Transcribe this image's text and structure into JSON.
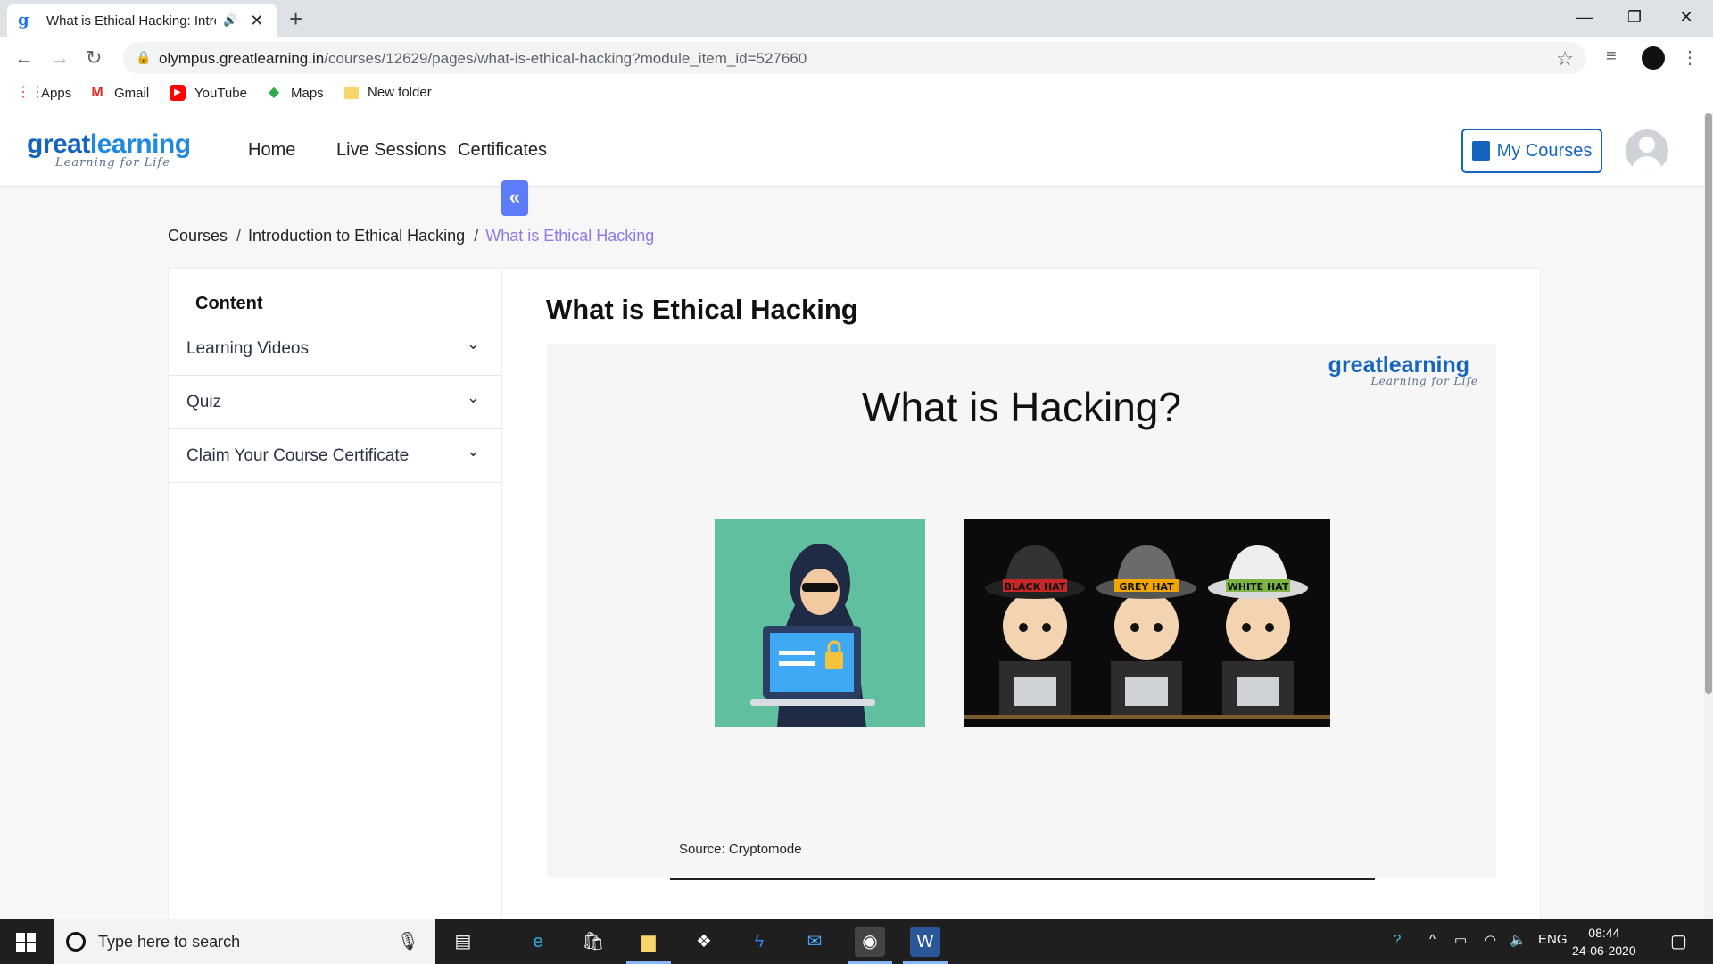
{
  "browser": {
    "tab_title": "What is Ethical Hacking: Intro",
    "new_tab": "+",
    "url_host": "olympus.greatlearning.in",
    "url_path": "/courses/12629/pages/what-is-ethical-hacking?module_item_id=527660",
    "bookmarks": [
      {
        "label": "Apps",
        "icon": "apps-grid-icon"
      },
      {
        "label": "Gmail",
        "icon": "gmail-icon"
      },
      {
        "label": "YouTube",
        "icon": "youtube-icon"
      },
      {
        "label": "Maps",
        "icon": "maps-icon"
      },
      {
        "label": "New folder",
        "icon": "folder-icon"
      }
    ]
  },
  "site": {
    "logo_word_1": "great",
    "logo_word_2": "learning",
    "logo_tagline": "Learning for Life",
    "nav": [
      "Home",
      "Live Sessions",
      "Certificates"
    ],
    "my_courses": "My Courses",
    "breadcrumb": [
      "Courses",
      "Introduction to Ethical Hacking",
      "What is Ethical Hacking"
    ],
    "breadcrumb_sep": "/"
  },
  "sidebar": {
    "heading": "Content",
    "items": [
      "Learning Videos",
      "Quiz",
      "Claim Your Course Certificate"
    ],
    "collapse_symbol": "«"
  },
  "main": {
    "page_title": "What is Ethical Hacking",
    "slide": {
      "logo_word": "greatlearning",
      "logo_tagline": "Learning for Life",
      "title": "What is Hacking?",
      "hats": [
        "BLACK HAT",
        "GREY HAT",
        "WHITE HAT"
      ],
      "source": "Source:  Cryptomode"
    }
  },
  "taskbar": {
    "search_placeholder": "Type here to search",
    "lang": "ENG",
    "time": "08:44",
    "date": "24-06-2020"
  },
  "colors": {
    "brand_blue": "#1565c0",
    "breadcrumb_current": "#8a7be8",
    "collapse_button": "#5c7cfa"
  }
}
